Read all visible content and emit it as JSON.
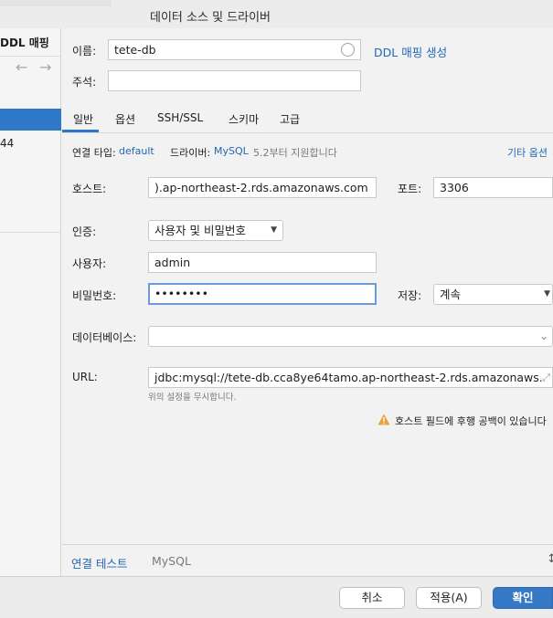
{
  "window": {
    "title": "데이터 소스 및 드라이버"
  },
  "sidebar": {
    "title": "DDL 매핑",
    "back_icon": "arrow-left-icon",
    "forward_icon": "arrow-right-icon",
    "item_partial": "44"
  },
  "form": {
    "name_label": "이름:",
    "name_value": "tete-db",
    "ddl_link": "DDL 매핑 생성",
    "comment_label": "주석:",
    "comment_value": ""
  },
  "tabs": [
    "일반",
    "옵션",
    "SSH/SSL",
    "스키마",
    "고급"
  ],
  "connection": {
    "type_label": "연결 타입:",
    "type_value": "default",
    "driver_label": "드라이버:",
    "driver_value": "MySQL",
    "driver_note": "5.2부터 지원합니다",
    "other_options": "기타 옵션"
  },
  "fields": {
    "host_label": "호스트:",
    "host_value": ").ap-northeast-2.rds.amazonaws.com",
    "port_label": "포트:",
    "port_value": "3306",
    "auth_label": "인증:",
    "auth_value": "사용자 및 비밀번호",
    "user_label": "사용자:",
    "user_value": "admin",
    "password_label": "비밀번호:",
    "password_value": "••••••••",
    "save_label": "저장:",
    "save_value": "계속",
    "database_label": "데이터베이스:",
    "database_value": "",
    "url_label": "URL:",
    "url_value": "jdbc:mysql://tete-db.cca8ye64tamo.ap-northeast-2.rds.amazonaws.",
    "url_note": "위의 설정을 무시합니다.",
    "warning_text": "호스트 필드에 후행 공백이 있습니다"
  },
  "footer": {
    "test_link": "연결 테스트",
    "driver_name": "MySQL"
  },
  "buttons": {
    "cancel": "취소",
    "apply": "적용(A)",
    "ok": "확인"
  },
  "colors": {
    "accent": "#2f77c9",
    "link": "#2467b3",
    "warning": "#e8a33d"
  }
}
